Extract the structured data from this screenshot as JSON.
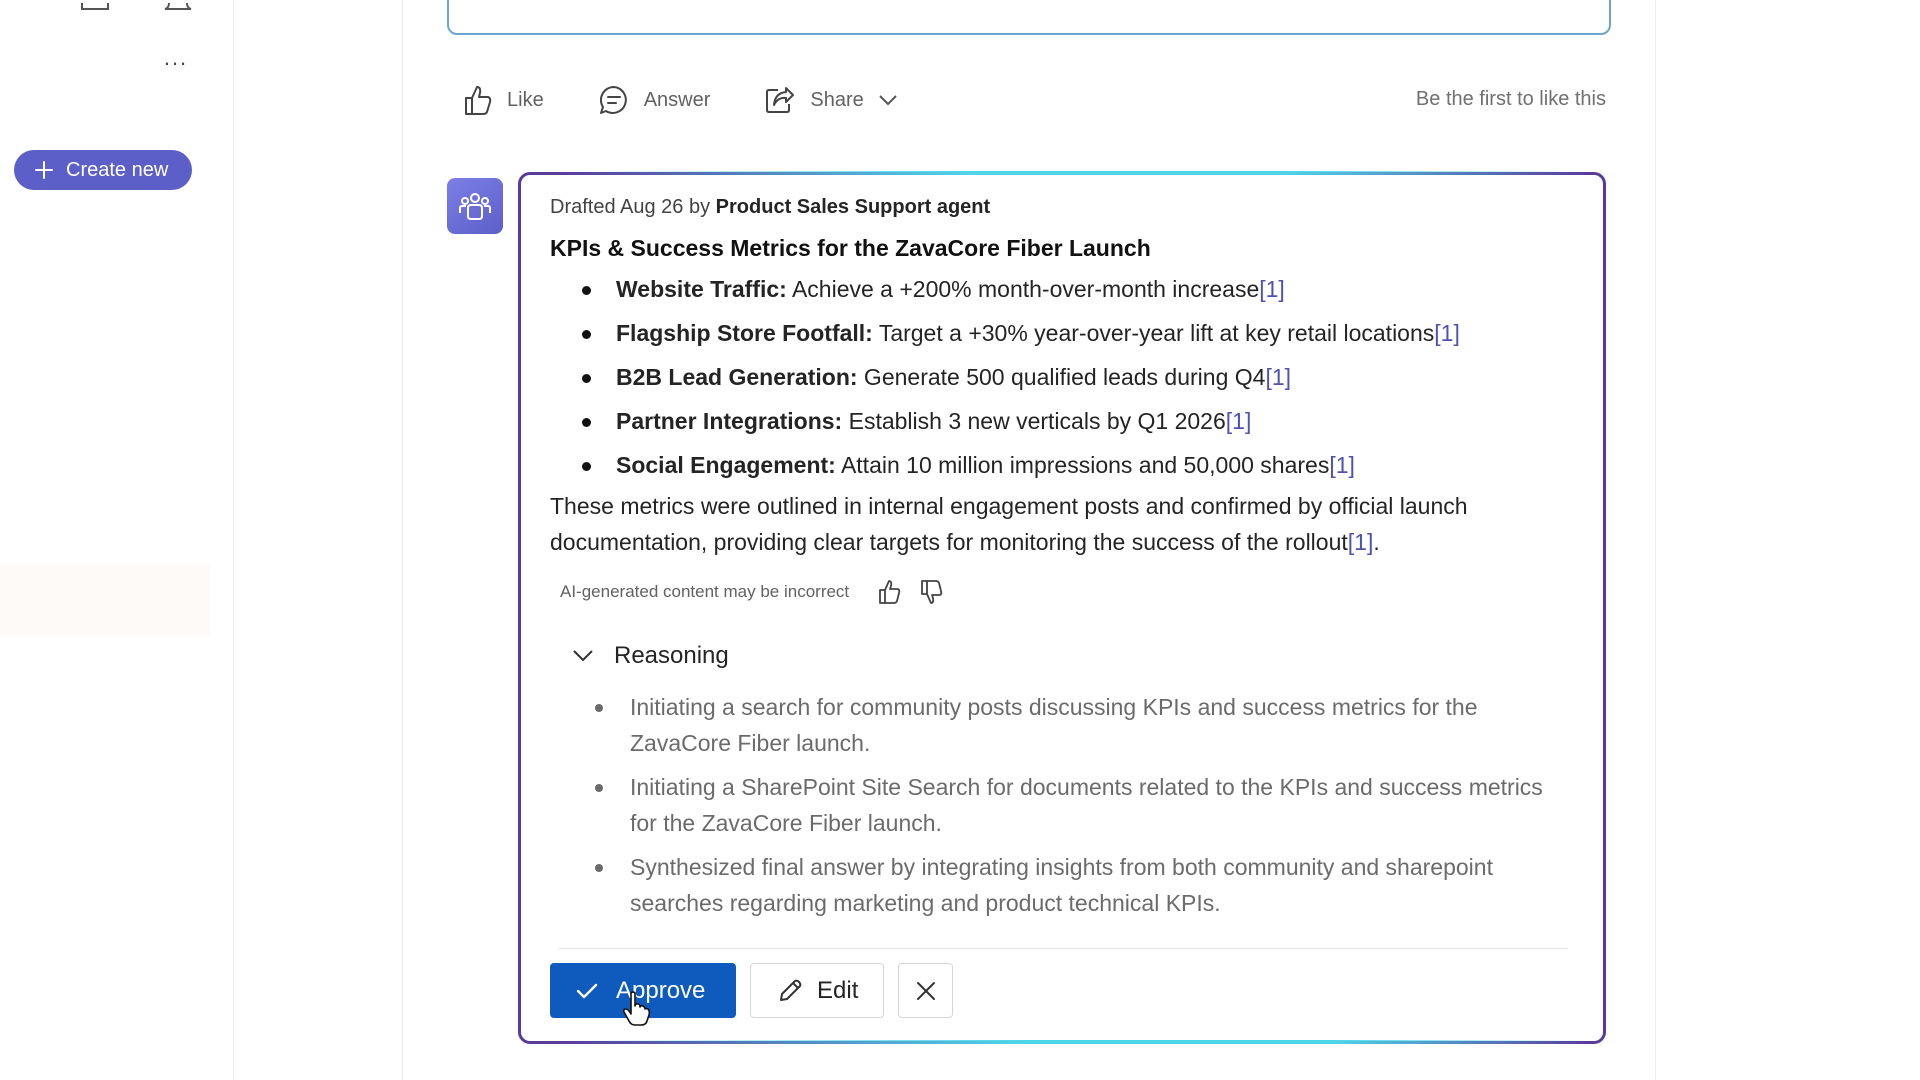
{
  "sidebar": {
    "more_label": "...",
    "create_new_label": "Create new"
  },
  "post_actions": {
    "like_label": "Like",
    "answer_label": "Answer",
    "share_label": "Share",
    "likes_text": "Be the first to like this"
  },
  "answer_card": {
    "drafted_prefix": "Drafted Aug 26 by ",
    "agent_name": "Product Sales Support agent",
    "title": "KPIs & Success Metrics for the ZavaCore Fiber Launch",
    "kpis": [
      {
        "label": "Website Traffic:",
        "text": " Achieve a +200% month-over-month increase",
        "ref": "[1]"
      },
      {
        "label": "Flagship Store Footfall:",
        "text": " Target a +30% year-over-year lift at key retail locations",
        "ref": "[1]"
      },
      {
        "label": "B2B Lead Generation:",
        "text": " Generate 500 qualified leads during Q4",
        "ref": "[1]"
      },
      {
        "label": "Partner Integrations:",
        "text": " Establish 3 new verticals by Q1 2026",
        "ref": "[1]"
      },
      {
        "label": "Social Engagement:",
        "text": " Attain 10 million impressions and 50,000 shares",
        "ref": "[1]"
      }
    ],
    "summary": "These metrics were outlined in internal engagement posts and confirmed by official launch documentation, providing clear targets for monitoring the success of the rollout",
    "summary_ref": "[1]",
    "summary_end": ".",
    "ai_note": "AI-generated content may be incorrect",
    "reasoning_label": "Reasoning",
    "reasoning_items": [
      "Initiating a search for community posts discussing KPIs and success metrics for the ZavaCore Fiber launch.",
      "Initiating a SharePoint Site Search for documents related to the KPIs and success metrics for the ZavaCore Fiber launch.",
      "Synthesized final answer by integrating insights from both community and sharepoint searches regarding marketing and product technical KPIs."
    ],
    "approve_label": "Approve",
    "edit_label": "Edit"
  },
  "colors": {
    "accent": "#5b5fc7",
    "approve_blue": "#0f5bbd",
    "card_border": "#5b3b9a",
    "glow": "#4fd5ea",
    "ref_link": "#4f52b2"
  },
  "icons": [
    "plus-icon",
    "like-icon",
    "answer-icon",
    "share-icon",
    "chevron-down-icon",
    "bot-avatar-icon",
    "thumbs-up-icon",
    "thumbs-down-icon",
    "checkmark-icon",
    "pencil-icon",
    "close-icon"
  ]
}
